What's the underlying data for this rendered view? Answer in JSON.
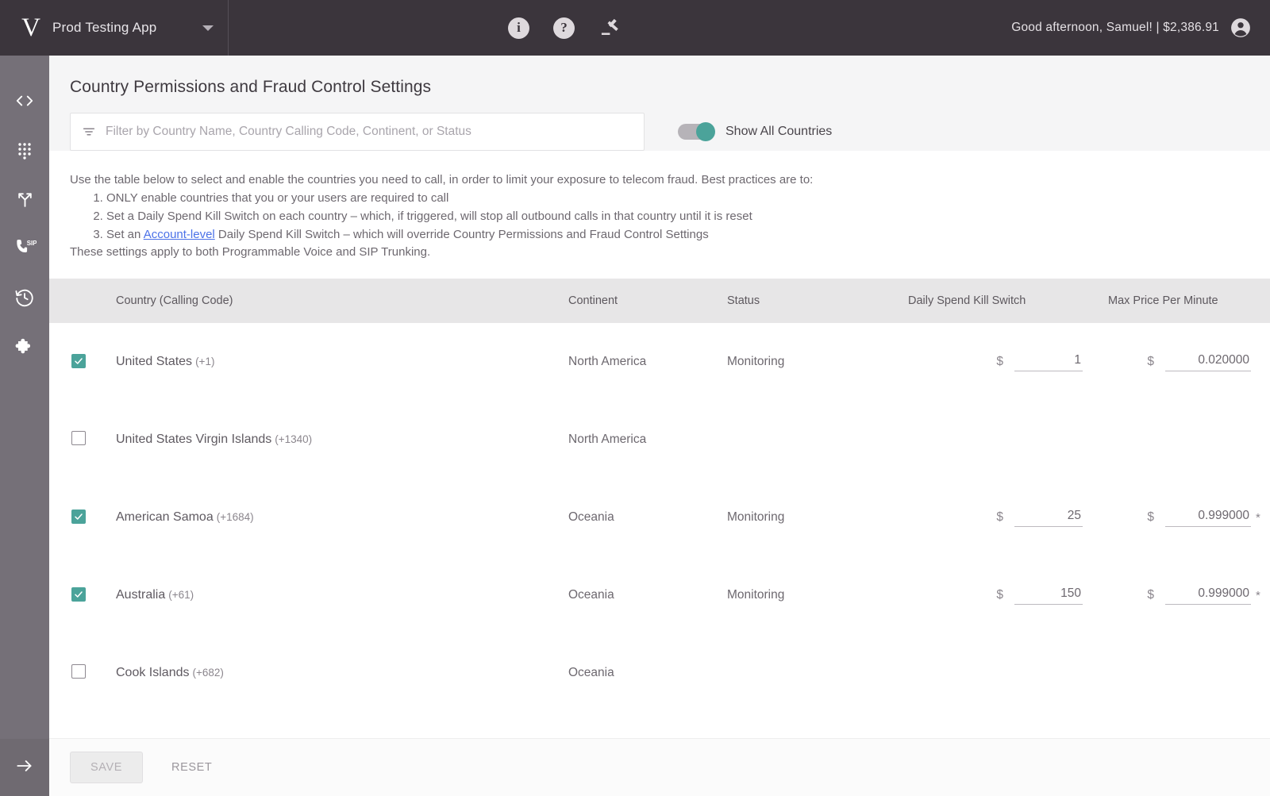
{
  "topbar": {
    "logo": "V",
    "app_name": "Prod Testing App",
    "dropdown_icon": "chevron-down-icon",
    "icons": [
      {
        "name": "info-icon",
        "glyph": "i"
      },
      {
        "name": "help-icon",
        "glyph": "?"
      },
      {
        "name": "gavel-icon",
        "glyph": "gavel"
      }
    ],
    "greeting": "Good afternoon, Samuel! | $2,386.91",
    "avatar": "user-avatar-icon"
  },
  "sidebar": {
    "items": [
      {
        "name": "code-icon",
        "label": "Code"
      },
      {
        "name": "dialpad-icon",
        "label": "Dialpad"
      },
      {
        "name": "routing-icon",
        "label": "Routing"
      },
      {
        "name": "sip-phone-icon",
        "label": "SIP"
      },
      {
        "name": "history-icon",
        "label": "History"
      },
      {
        "name": "puzzle-icon",
        "label": "Integrations"
      }
    ],
    "expand": {
      "name": "expand-arrow-icon",
      "label": "Expand"
    }
  },
  "page": {
    "title": "Country Permissions and Fraud Control Settings"
  },
  "filter": {
    "icon": "filter-icon",
    "value": "",
    "placeholder": "Filter by Country Name, Country Calling Code, Continent, or Status"
  },
  "show_all_toggle": {
    "label": "Show All Countries",
    "state": "on",
    "accent_color": "#4ba39a"
  },
  "instructions": {
    "intro": "Use the table below to select and enable the countries you need to call, in order to limit your exposure to telecom fraud. Best practices are to:",
    "steps": [
      {
        "text": "ONLY enable countries that you or your users are required to call"
      },
      {
        "text": "Set a Daily Spend Kill Switch on each country – which, if triggered, will stop all outbound calls in that country until it is reset"
      },
      {
        "prefix": "Set an ",
        "link": "Account-level",
        "suffix": " Daily Spend Kill Switch – which will override Country Permissions and Fraud Control Settings"
      }
    ],
    "footnote": "These settings apply to both Programmable Voice and SIP Trunking."
  },
  "table": {
    "headers": {
      "checkbox": "",
      "country": "Country (Calling Code)",
      "continent": "Continent",
      "status": "Status",
      "kill_switch": "Daily Spend Kill Switch",
      "max_price": "Max Price Per Minute"
    },
    "currency_symbol": "$",
    "rows": [
      {
        "enabled": true,
        "country": "United States",
        "calling_code": "(+1)",
        "continent": "North America",
        "status": "Monitoring",
        "kill_switch": "1",
        "max_price": "0.020000",
        "max_price_star": ""
      },
      {
        "enabled": false,
        "country": "United States Virgin Islands",
        "calling_code": "(+1340)",
        "continent": "North America",
        "status": "",
        "kill_switch": "",
        "max_price": "",
        "max_price_star": ""
      },
      {
        "enabled": true,
        "country": "American Samoa",
        "calling_code": "(+1684)",
        "continent": "Oceania",
        "status": "Monitoring",
        "kill_switch": "25",
        "max_price": "0.999000",
        "max_price_star": "*"
      },
      {
        "enabled": true,
        "country": "Australia",
        "calling_code": "(+61)",
        "continent": "Oceania",
        "status": "Monitoring",
        "kill_switch": "150",
        "max_price": "0.999000",
        "max_price_star": "*"
      },
      {
        "enabled": false,
        "country": "Cook Islands",
        "calling_code": "(+682)",
        "continent": "Oceania",
        "status": "",
        "kill_switch": "",
        "max_price": "",
        "max_price_star": ""
      }
    ]
  },
  "footer": {
    "save_label": "SAVE",
    "reset_label": "RESET"
  }
}
